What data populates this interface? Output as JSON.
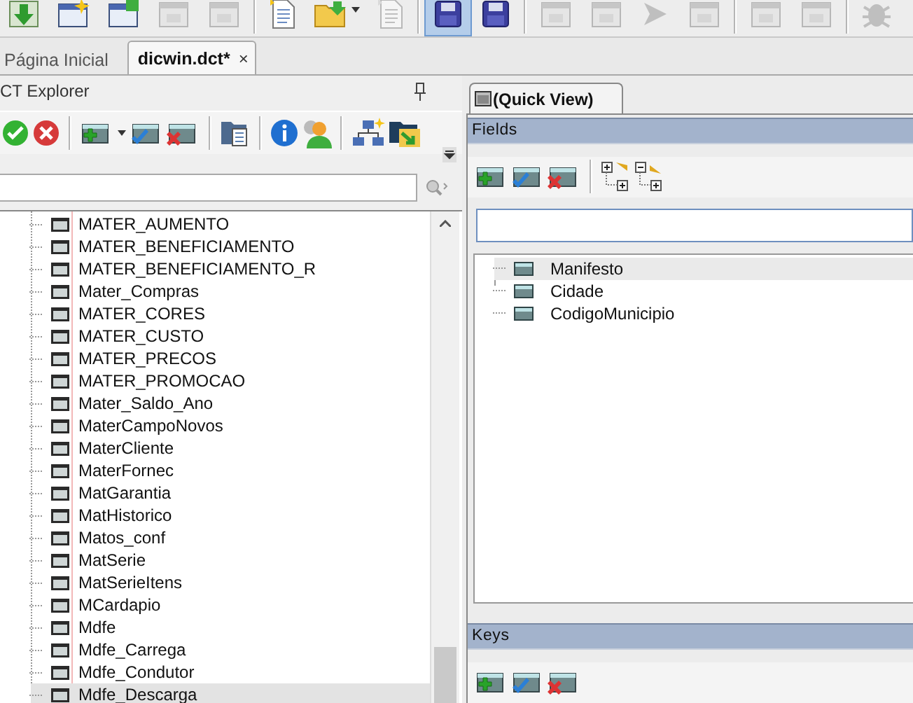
{
  "toolbar": [
    {
      "kind": "import",
      "disabled": false,
      "selected": false
    },
    {
      "kind": "window-new",
      "disabled": false,
      "selected": false
    },
    {
      "kind": "window-copy",
      "disabled": false,
      "selected": false
    },
    {
      "kind": "window",
      "disabled": true,
      "selected": false
    },
    {
      "kind": "window",
      "disabled": true,
      "selected": false
    },
    {
      "kind": "separator"
    },
    {
      "kind": "document",
      "disabled": false,
      "selected": false
    },
    {
      "kind": "folder",
      "disabled": false,
      "selected": false
    },
    {
      "kind": "document",
      "disabled": true,
      "selected": false
    },
    {
      "kind": "separator"
    },
    {
      "kind": "save",
      "disabled": false,
      "selected": true
    },
    {
      "kind": "save",
      "disabled": false,
      "selected": false
    },
    {
      "kind": "separator"
    },
    {
      "kind": "window",
      "disabled": true,
      "selected": false
    },
    {
      "kind": "window",
      "disabled": true,
      "selected": false
    },
    {
      "kind": "arrow",
      "disabled": true,
      "selected": false
    },
    {
      "kind": "window",
      "disabled": true,
      "selected": false
    },
    {
      "kind": "separator"
    },
    {
      "kind": "window",
      "disabled": true,
      "selected": false
    },
    {
      "kind": "window",
      "disabled": true,
      "selected": false
    },
    {
      "kind": "separator"
    },
    {
      "kind": "bug",
      "disabled": true,
      "selected": false
    }
  ],
  "doc_tabs": [
    {
      "label": "Página Inicial",
      "selected": false
    },
    {
      "label": "dicwin.dct*",
      "selected": true,
      "close": "×"
    }
  ],
  "explorer": {
    "title": "CT Explorer",
    "tree": [
      {
        "label": "MATER_AUMENTO",
        "selected": false
      },
      {
        "label": "MATER_BENEFICIAMENTO",
        "selected": false
      },
      {
        "label": "MATER_BENEFICIAMENTO_R",
        "selected": false
      },
      {
        "label": "Mater_Compras",
        "selected": false
      },
      {
        "label": "MATER_CORES",
        "selected": false
      },
      {
        "label": "MATER_CUSTO",
        "selected": false
      },
      {
        "label": "MATER_PRECOS",
        "selected": false
      },
      {
        "label": "MATER_PROMOCAO",
        "selected": false
      },
      {
        "label": "Mater_Saldo_Ano",
        "selected": false
      },
      {
        "label": "MaterCampoNovos",
        "selected": false
      },
      {
        "label": "MaterCliente",
        "selected": false
      },
      {
        "label": "MaterFornec",
        "selected": false
      },
      {
        "label": "MatGarantia",
        "selected": false
      },
      {
        "label": "MatHistorico",
        "selected": false
      },
      {
        "label": "Matos_conf",
        "selected": false
      },
      {
        "label": "MatSerie",
        "selected": false
      },
      {
        "label": "MatSerieItens",
        "selected": false
      },
      {
        "label": "MCardapio",
        "selected": false
      },
      {
        "label": "Mdfe",
        "selected": false
      },
      {
        "label": "Mdfe_Carrega",
        "selected": false
      },
      {
        "label": "Mdfe_Condutor",
        "selected": false
      },
      {
        "label": "Mdfe_Descarga",
        "selected": true
      }
    ]
  },
  "quick_view": {
    "tab": "(Quick View)",
    "fields": {
      "title": "Fields",
      "items": [
        {
          "label": "Manifesto",
          "selected": true
        },
        {
          "label": "Cidade",
          "selected": false
        },
        {
          "label": "CodigoMunicipio",
          "selected": false
        }
      ]
    },
    "keys": {
      "title": "Keys"
    }
  }
}
